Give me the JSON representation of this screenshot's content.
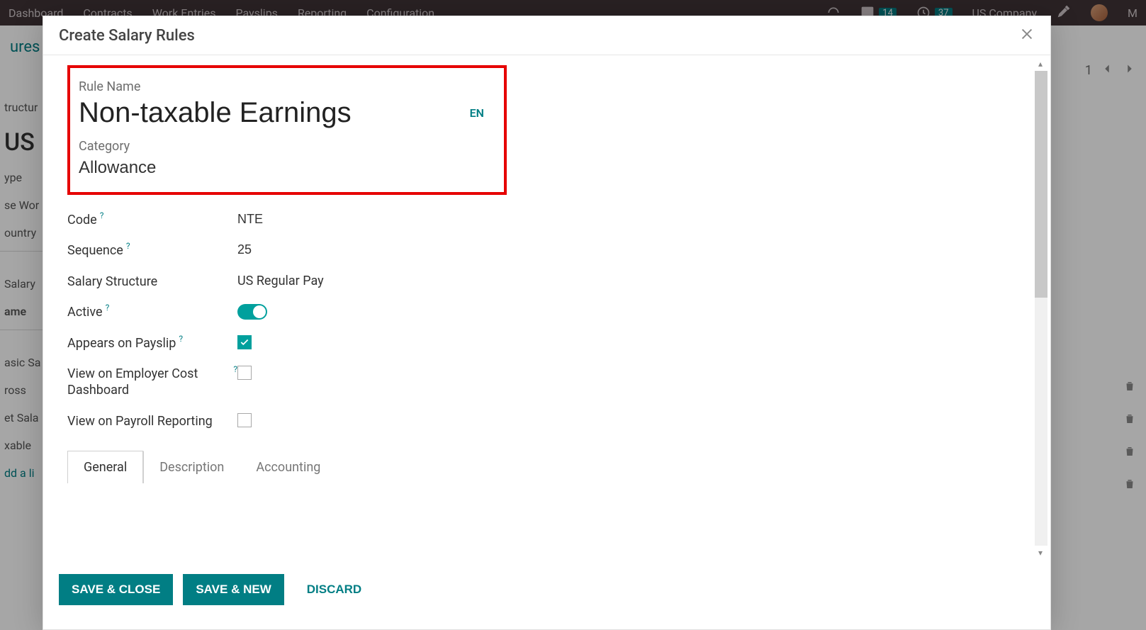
{
  "nav": {
    "items": [
      "Dashboard",
      "Contracts",
      "Work Entries",
      "Payslips",
      "Reporting",
      "Configuration"
    ],
    "msg_count": "14",
    "activity_count": "37",
    "company": "US Company",
    "user_initial": "M"
  },
  "breadcrumb": "ures",
  "pager": {
    "count": "1"
  },
  "left_partial": [
    "tructur",
    "US",
    "ype",
    "se Wor",
    "ountry",
    "Salary",
    "ame",
    "asic Sa",
    "ross",
    "et Sala",
    "xable",
    "dd a li"
  ],
  "modal": {
    "title": "Create Salary Rules",
    "rule_name_label": "Rule Name",
    "rule_name_value": "Non-taxable Earnings",
    "lang_badge": "EN",
    "category_label": "Category",
    "category_value": "Allowance",
    "fields": {
      "code_label": "Code",
      "code_value": "NTE",
      "sequence_label": "Sequence",
      "sequence_value": "25",
      "structure_label": "Salary Structure",
      "structure_value": "US Regular Pay",
      "active_label": "Active",
      "active_value": true,
      "payslip_label": "Appears on Payslip",
      "payslip_value": true,
      "employer_cost_label": "View on Employer Cost Dashboard",
      "employer_cost_value": false,
      "payroll_report_label": "View on Payroll Reporting",
      "payroll_report_value": false
    },
    "tabs": [
      "General",
      "Description",
      "Accounting"
    ],
    "buttons": {
      "save_close": "SAVE & CLOSE",
      "save_new": "SAVE & NEW",
      "discard": "DISCARD"
    }
  }
}
